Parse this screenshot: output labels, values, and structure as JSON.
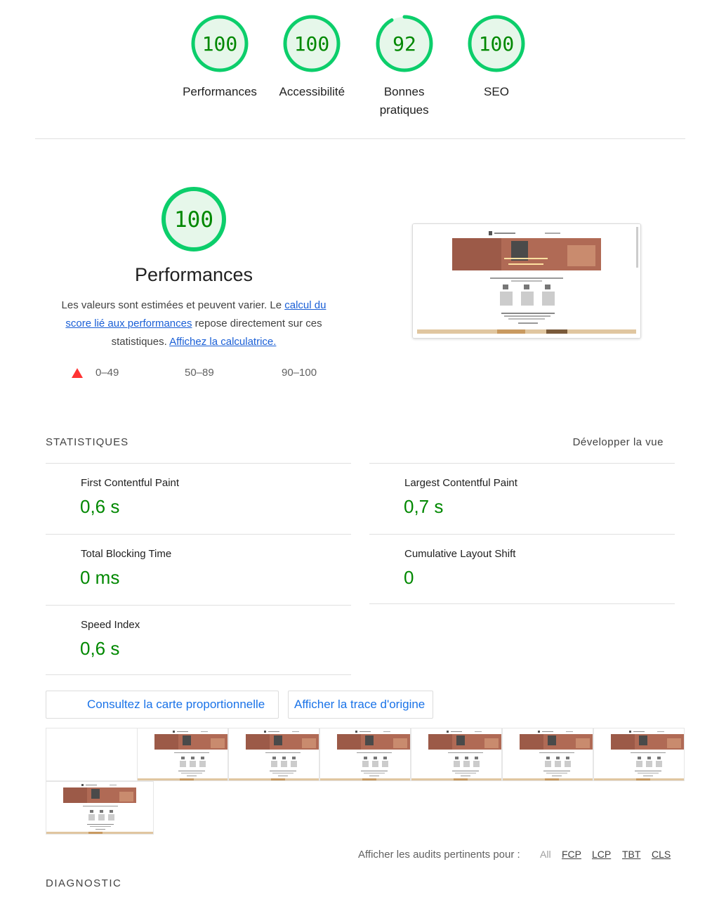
{
  "colors": {
    "pass": "#0cce6b",
    "pass_text": "#008800",
    "pass_fill": "#e6f7ea",
    "fail": "#ff3333",
    "link": "#1a5fd6"
  },
  "gauges": [
    {
      "score": 100,
      "label": "Performances"
    },
    {
      "score": 100,
      "label": "Accessibilité"
    },
    {
      "score": 92,
      "label": "Bonnes pratiques"
    },
    {
      "score": 100,
      "label": "SEO"
    }
  ],
  "performance": {
    "score": 100,
    "title": "Performances",
    "desc_before": "Les valeurs sont estimées et peuvent varier. Le ",
    "desc_link1": "calcul du score lié aux performances",
    "desc_middle": " repose directement sur ces statistiques. ",
    "desc_link2": "Affichez la calculatrice."
  },
  "legend": {
    "fail": "0–49",
    "average": "50–89",
    "pass": "90–100"
  },
  "stats": {
    "title": "STATISTIQUES",
    "toggle": "Développer la vue",
    "metrics": [
      {
        "title": "First Contentful Paint",
        "value": "0,6 s"
      },
      {
        "title": "Largest Contentful Paint",
        "value": "0,7 s"
      },
      {
        "title": "Total Blocking Time",
        "value": "0 ms"
      },
      {
        "title": "Cumulative Layout Shift",
        "value": "0"
      },
      {
        "title": "Speed Index",
        "value": "0,6 s"
      }
    ]
  },
  "buttons": {
    "treemap": "Consultez la carte proportionnelle",
    "trace": "Afficher la trace d'origine"
  },
  "audit_filter": {
    "label": "Afficher les audits pertinents pour :",
    "chips": [
      "All",
      "FCP",
      "LCP",
      "TBT",
      "CLS"
    ]
  },
  "diagnostic": {
    "title": "DIAGNOSTIC"
  }
}
